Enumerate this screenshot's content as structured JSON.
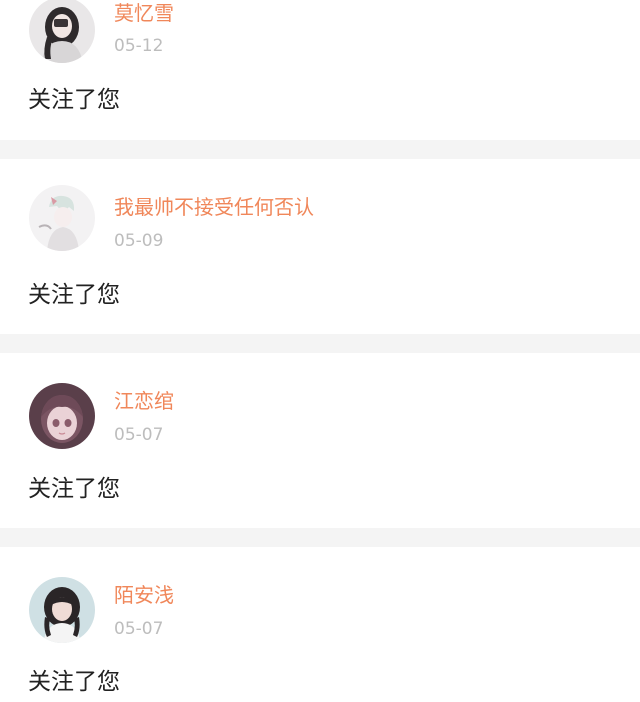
{
  "colors": {
    "username": "#f0875a",
    "date": "#bdbdbd",
    "message": "#222222",
    "card_bg": "#ffffff",
    "gap_bg": "#f4f4f4"
  },
  "notifications": [
    {
      "username": "莫忆雪",
      "date": "05-12",
      "message": "关注了您",
      "avatar": "avatar-girl-dark-hair-icon"
    },
    {
      "username": "我最帅不接受任何否认",
      "date": "05-09",
      "message": "关注了您",
      "avatar": "avatar-anime-character-icon"
    },
    {
      "username": "江恋绾",
      "date": "05-07",
      "message": "关注了您",
      "avatar": "avatar-anime-girl-icon"
    },
    {
      "username": "陌安浅",
      "date": "05-07",
      "message": "关注了您",
      "avatar": "avatar-girl-photo-icon"
    }
  ]
}
